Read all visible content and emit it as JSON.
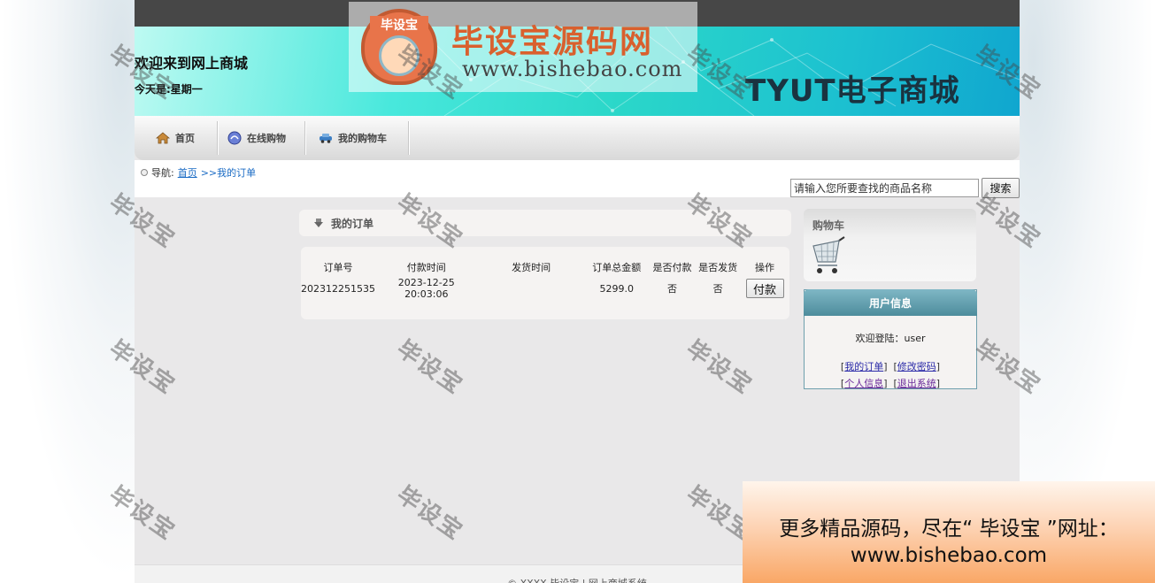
{
  "header": {
    "welcome": "欢迎来到网上商城",
    "today": "今天是:星期一",
    "store_title": "TYUT电子商城"
  },
  "logo": {
    "emblem_text": "毕设宝",
    "title": "毕设宝源码网",
    "url": "www.bishebao.com"
  },
  "nav": {
    "items": [
      {
        "label": "首页",
        "icon": "home-icon"
      },
      {
        "label": "在线购物",
        "icon": "shopping-icon"
      },
      {
        "label": "我的购物车",
        "icon": "car-icon"
      }
    ]
  },
  "breadcrumb": {
    "prefix": "导航:",
    "home": "首页",
    "current": ">>我的订单"
  },
  "search": {
    "value": "请输入您所要查找的商品名称",
    "button": "搜索"
  },
  "orders": {
    "title": "我的订单",
    "columns": [
      "订单号",
      "付款时间",
      "发货时间",
      "订单总金额",
      "是否付款",
      "是否发货",
      "操作"
    ],
    "rows": [
      {
        "order_no": "202312251535",
        "pay_time": "2023-12-25 20:03:06",
        "ship_time": "",
        "total": "5299.0",
        "paid": "否",
        "shipped": "否",
        "action": "付款"
      }
    ]
  },
  "cart": {
    "title": "购物车",
    "icon": "shopping-cart-icon"
  },
  "user_info": {
    "title": "用户信息",
    "welcome": "欢迎登陆：user",
    "links": [
      "我的订单",
      "修改密码",
      "个人信息",
      "退出系统"
    ]
  },
  "footer": {
    "text": "© XXXX 毕设宝 | 网上商城系统"
  },
  "watermark": "毕设宝",
  "promo": {
    "line1": "更多精品源码，尽在“ 毕设宝 ”网址：",
    "line2": "www.bishebao.com"
  },
  "colors": {
    "topbar": "#474747",
    "user_head": "#4d8c9c",
    "link": "#1a6bc4",
    "logo_orange": "#d9602e"
  }
}
